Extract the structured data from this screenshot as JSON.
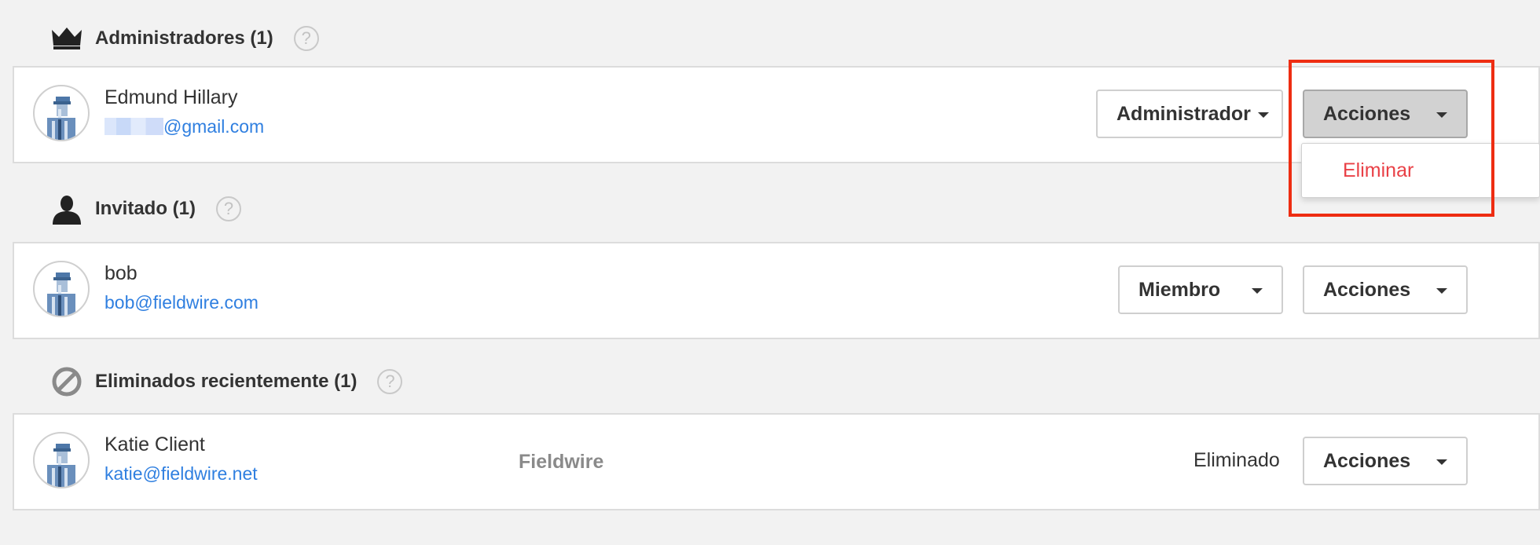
{
  "colors": {
    "background": "#f2f2f2",
    "link": "#2f7fe0",
    "danger": "#e94046",
    "highlight": "#ee2d12"
  },
  "sections": {
    "admins": {
      "icon": "crown-icon",
      "title": "Administradores (1)",
      "help": "?"
    },
    "guests": {
      "icon": "user-silhouette-icon",
      "title": "Invitado (1)",
      "help": "?"
    },
    "removed": {
      "icon": "prohibited-icon",
      "title": "Eliminados recientemente (1)",
      "help": "?"
    }
  },
  "users": {
    "admin": {
      "name": "Edmund Hillary",
      "email_domain": "@gmail.com",
      "role": "Administrador",
      "actions": "Acciones"
    },
    "guest": {
      "name": "bob",
      "email": "bob@fieldwire.com",
      "role": "Miembro",
      "actions": "Acciones"
    },
    "removed": {
      "name": "Katie Client",
      "email": "katie@fieldwire.net",
      "company": "Fieldwire",
      "status": "Eliminado",
      "actions": "Acciones"
    }
  },
  "dropdown": {
    "items": [
      "Eliminar"
    ]
  }
}
